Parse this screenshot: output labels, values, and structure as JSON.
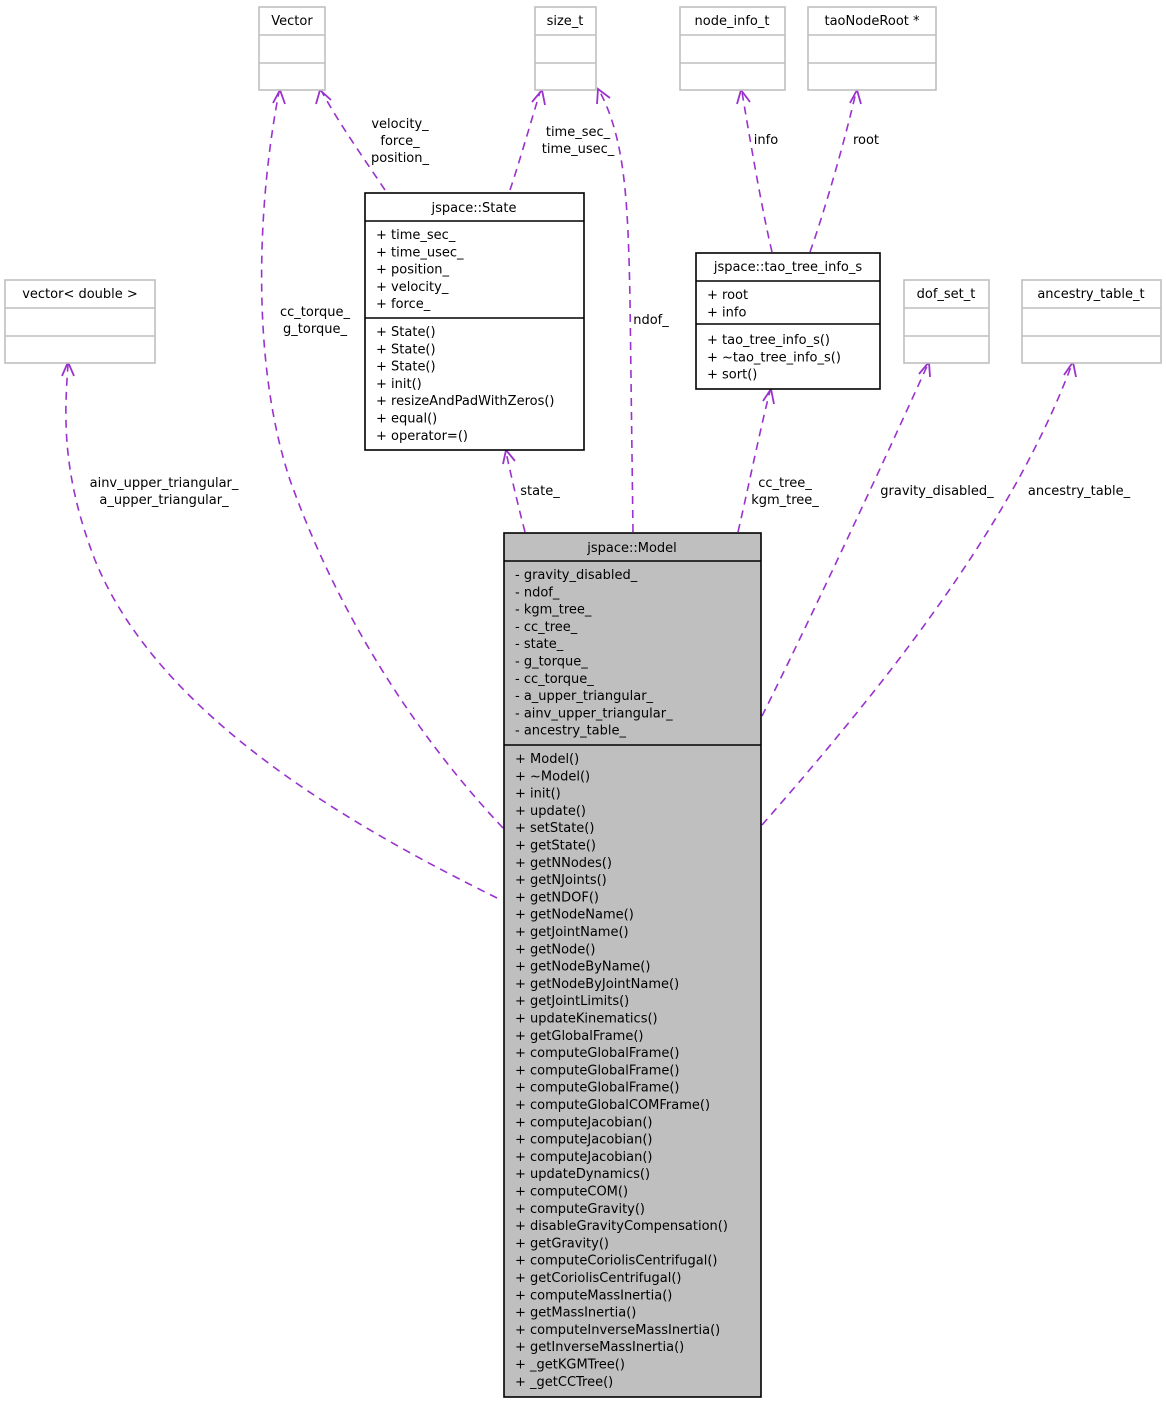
{
  "diagram": {
    "edge_color": "#9a32cd",
    "main_fill": "#bfbfbf",
    "classes": {
      "vector": {
        "title": "Vector"
      },
      "size_t": {
        "title": "size_t"
      },
      "node_info_t": {
        "title": "node_info_t"
      },
      "taoNodeRoot": {
        "title": "taoNodeRoot *"
      },
      "vector_double": {
        "title": "vector< double >"
      },
      "dof_set_t": {
        "title": "dof_set_t"
      },
      "ancestry_table_t": {
        "title": "ancestry_table_t"
      },
      "state": {
        "title": "jspace::State",
        "attributes": [
          "+ time_sec_",
          "+ time_usec_",
          "+ position_",
          "+ velocity_",
          "+ force_"
        ],
        "methods": [
          "+ State()",
          "+ State()",
          "+ State()",
          "+ init()",
          "+ resizeAndPadWithZeros()",
          "+ equal()",
          "+ operator=()"
        ]
      },
      "tao_tree_info": {
        "title": "jspace::tao_tree_info_s",
        "attributes": [
          "+ root",
          "+ info"
        ],
        "methods": [
          "+ tao_tree_info_s()",
          "+ ~tao_tree_info_s()",
          "+ sort()"
        ]
      },
      "model": {
        "title": "jspace::Model",
        "attributes": [
          "- gravity_disabled_",
          "- ndof_",
          "- kgm_tree_",
          "- cc_tree_",
          "- state_",
          "- g_torque_",
          "- cc_torque_",
          "- a_upper_triangular_",
          "- ainv_upper_triangular_",
          "- ancestry_table_"
        ],
        "methods": [
          "+ Model()",
          "+ ~Model()",
          "+ init()",
          "+ update()",
          "+ setState()",
          "+ getState()",
          "+ getNNodes()",
          "+ getNJoints()",
          "+ getNDOF()",
          "+ getNodeName()",
          "+ getJointName()",
          "+ getNode()",
          "+ getNodeByName()",
          "+ getNodeByJointName()",
          "+ getJointLimits()",
          "+ updateKinematics()",
          "+ getGlobalFrame()",
          "+ computeGlobalFrame()",
          "+ computeGlobalFrame()",
          "+ computeGlobalFrame()",
          "+ computeGlobalCOMFrame()",
          "+ computeJacobian()",
          "+ computeJacobian()",
          "+ computeJacobian()",
          "+ updateDynamics()",
          "+ computeCOM()",
          "+ computeGravity()",
          "+ disableGravityCompensation()",
          "+ getGravity()",
          "+ computeCoriolisCentrifugal()",
          "+ getCoriolisCentrifugal()",
          "+ computeMassInertia()",
          "+ getMassInertia()",
          "+ computeInverseMassInertia()",
          "+ getInverseMassInertia()",
          "+ _getKGMTree()",
          "+ _getCCTree()"
        ]
      }
    },
    "edges": {
      "state_vector": [
        "velocity_",
        "force_",
        "position_"
      ],
      "state_size_t": [
        "time_sec_",
        "time_usec_"
      ],
      "tao_node_info": [
        "info"
      ],
      "tao_root": [
        "root"
      ],
      "model_vector": [
        "cc_torque_",
        "g_torque_"
      ],
      "model_size_t": [
        "ndof_"
      ],
      "model_vector_double": [
        "ainv_upper_triangular_",
        "a_upper_triangular_"
      ],
      "model_state": [
        "state_"
      ],
      "model_tao": [
        "cc_tree_",
        "kgm_tree_"
      ],
      "model_dof_set": [
        "gravity_disabled_"
      ],
      "model_ancestry": [
        "ancestry_table_"
      ]
    }
  }
}
